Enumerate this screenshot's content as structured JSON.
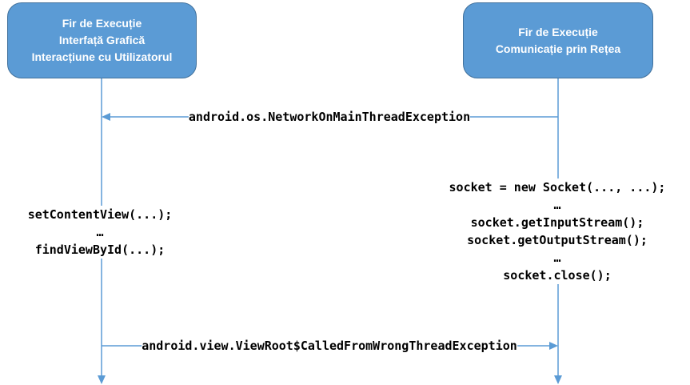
{
  "participants": {
    "ui_thread": {
      "line1": "Fir de Execuție",
      "line2": "Interfață Grafică",
      "line3": "Interacțiune cu Utilizatorul"
    },
    "network_thread": {
      "line1": "Fir de Execuție",
      "line2": "Comunicație prin Rețea"
    }
  },
  "messages": {
    "network_on_main": "android.os.NetworkOnMainThreadException",
    "wrong_thread": "android.view.ViewRoot$CalledFromWrongThreadException"
  },
  "ui_code": {
    "line1": "setContentView(...);",
    "line2": "…",
    "line3": "findViewById(...);"
  },
  "network_code": {
    "line1": "socket = new Socket(..., ...);",
    "line2": "…",
    "line3": "socket.getInputStream();",
    "line4": "socket.getOutputStream();",
    "line5": "…",
    "line6": "socket.close();"
  },
  "colors": {
    "box_fill": "#5b9bd5",
    "box_border": "#41719c",
    "line": "#5b9bd5",
    "text": "#000000"
  }
}
